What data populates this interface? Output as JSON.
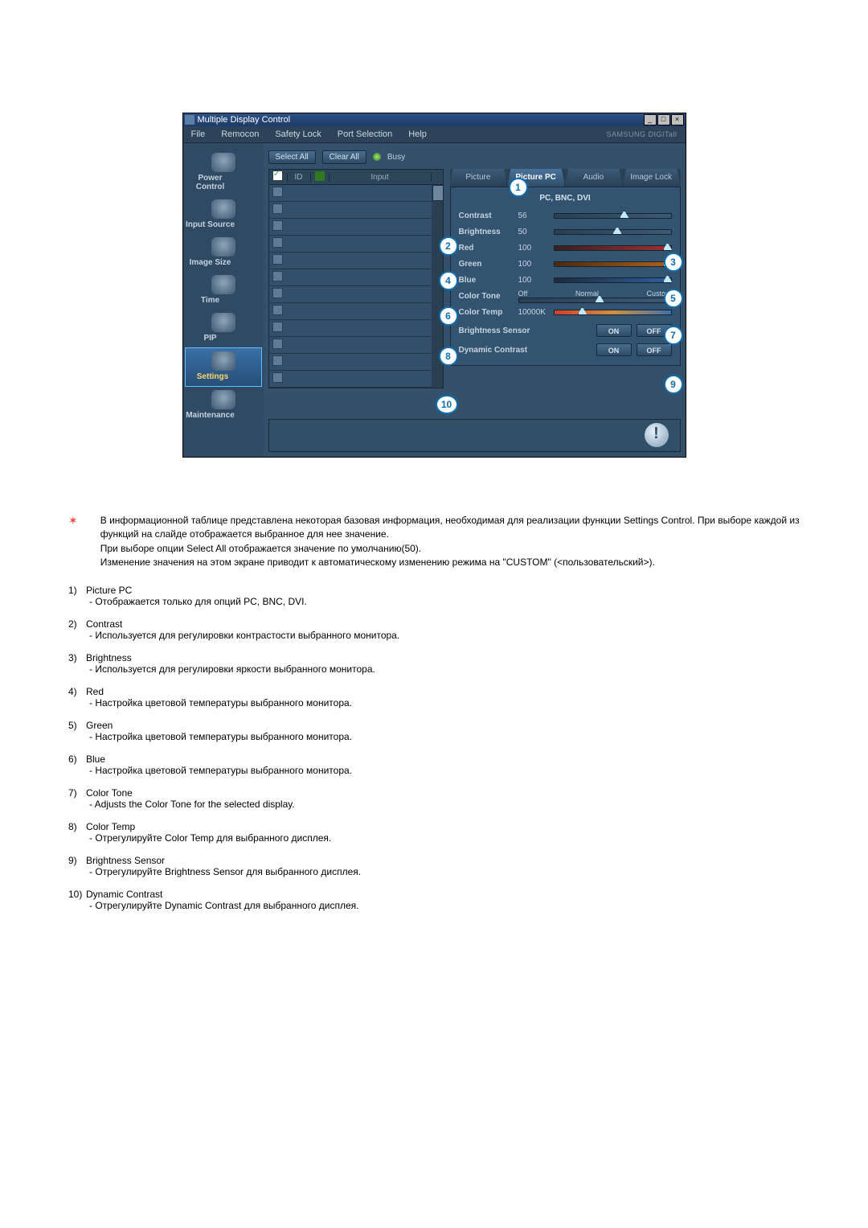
{
  "window": {
    "title": "Multiple Display Control",
    "brand": "SAMSUNG DIGITall"
  },
  "menu": [
    "File",
    "Remocon",
    "Safety Lock",
    "Port Selection",
    "Help"
  ],
  "sidebar": [
    {
      "label": "Power Control"
    },
    {
      "label": "Input Source"
    },
    {
      "label": "Image Size"
    },
    {
      "label": "Time"
    },
    {
      "label": "PIP"
    },
    {
      "label": "Settings"
    },
    {
      "label": "Maintenance"
    }
  ],
  "buttons": {
    "selectAll": "Select All",
    "clearAll": "Clear All",
    "busy": "Busy"
  },
  "grid": {
    "cols": {
      "id": "ID",
      "input": "Input"
    },
    "rowCount": 12
  },
  "tabs": [
    "Picture",
    "Picture PC",
    "Audio",
    "Image Lock"
  ],
  "panel": {
    "sub": "PC, BNC, DVI",
    "contrast": {
      "label": "Contrast",
      "value": "56",
      "pct": 56
    },
    "brightness": {
      "label": "Brightness",
      "value": "50",
      "pct": 50
    },
    "red": {
      "label": "Red",
      "value": "100",
      "pct": 100
    },
    "green": {
      "label": "Green",
      "value": "100",
      "pct": 100
    },
    "blue": {
      "label": "Blue",
      "value": "100",
      "pct": 100
    },
    "colortone": {
      "label": "Color Tone",
      "opts": [
        "Off",
        "Normal",
        "Custom"
      ],
      "pct": 50
    },
    "colortemp": {
      "label": "Color Temp",
      "value": "10000K",
      "pct": 20
    },
    "bsensor": {
      "label": "Brightness Sensor",
      "on": "ON",
      "off": "OFF"
    },
    "dcontrast": {
      "label": "Dynamic Contrast",
      "on": "ON",
      "off": "OFF"
    }
  },
  "bubbles": {
    "b1": "1",
    "b2": "2",
    "b3": "3",
    "b4": "4",
    "b5": "5",
    "b6": "6",
    "b7": "7",
    "b8": "8",
    "b9": "9",
    "b10": "10"
  },
  "notes": {
    "star": "В информационной таблице представлена некоторая базовая информация, необходимая для реализации функции Settings Control. При выборе каждой из функций на слайде отображается выбранное для нее значение.",
    "star2": "При выборе опции Select All отображается значение по умолчанию(50).",
    "star3": "Изменение значения на этом экране приводит к автоматическому изменению режима на \"CUSTOM\" (<пользовательский>)."
  },
  "items": [
    {
      "n": "1)",
      "t": "Picture PC",
      "d": "- Отображается только для опций PC, BNC, DVI."
    },
    {
      "n": "2)",
      "t": "Contrast",
      "d": "- Используется для регулировки контрастости выбранного монитора."
    },
    {
      "n": "3)",
      "t": "Brightness",
      "d": "- Используется для регулировки яркости выбранного монитора."
    },
    {
      "n": "4)",
      "t": "Red",
      "d": "- Настройка цветовой температуры выбранного монитора."
    },
    {
      "n": "5)",
      "t": "Green",
      "d": "- Настройка цветовой температуры выбранного монитора."
    },
    {
      "n": "6)",
      "t": "Blue",
      "d": "- Настройка цветовой температуры выбранного монитора."
    },
    {
      "n": "7)",
      "t": "Color Tone",
      "d": "- Adjusts the Color Tone for the selected display."
    },
    {
      "n": "8)",
      "t": "Color Temp",
      "d": "- Отрегулируйте Color Temp для выбранного дисплея."
    },
    {
      "n": "9)",
      "t": "Brightness Sensor",
      "d": "- Отрегулируйте Brightness Sensor для выбранного дисплея."
    },
    {
      "n": "10)",
      "t": "Dynamic Contrast",
      "d": "- Отрегулируйте Dynamic Contrast для выбранного дисплея."
    }
  ]
}
